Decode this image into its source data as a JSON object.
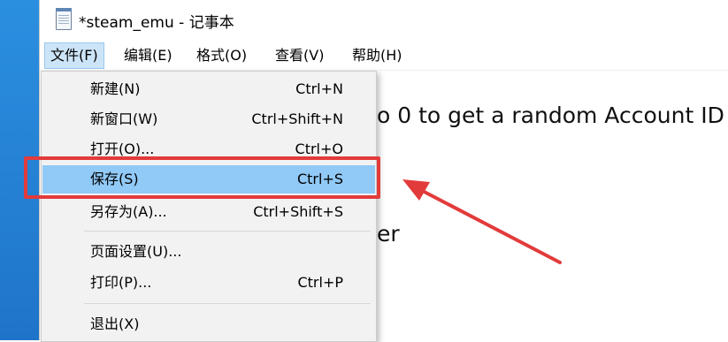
{
  "window": {
    "title": "*steam_emu - 记事本"
  },
  "menubar": {
    "items": [
      {
        "label": "文件(F)"
      },
      {
        "label": "编辑(E)"
      },
      {
        "label": "格式(O)"
      },
      {
        "label": "查看(V)"
      },
      {
        "label": "帮助(H)"
      }
    ]
  },
  "editor": {
    "lines": [
      "o 0 to get a random Account ID",
      "er"
    ]
  },
  "file_menu": {
    "items": [
      {
        "label": "新建(N)",
        "shortcut": "Ctrl+N"
      },
      {
        "label": "新窗口(W)",
        "shortcut": "Ctrl+Shift+N"
      },
      {
        "label": "打开(O)...",
        "shortcut": "Ctrl+O"
      },
      {
        "label": "保存(S)",
        "shortcut": "Ctrl+S"
      },
      {
        "label": "另存为(A)...",
        "shortcut": "Ctrl+Shift+S"
      },
      {
        "label": "页面设置(U)...",
        "shortcut": ""
      },
      {
        "label": "打印(P)...",
        "shortcut": "Ctrl+P"
      },
      {
        "label": "退出(X)",
        "shortcut": ""
      }
    ]
  },
  "colors": {
    "highlight": "#91c9f7",
    "annotation": "#e23b3b"
  }
}
